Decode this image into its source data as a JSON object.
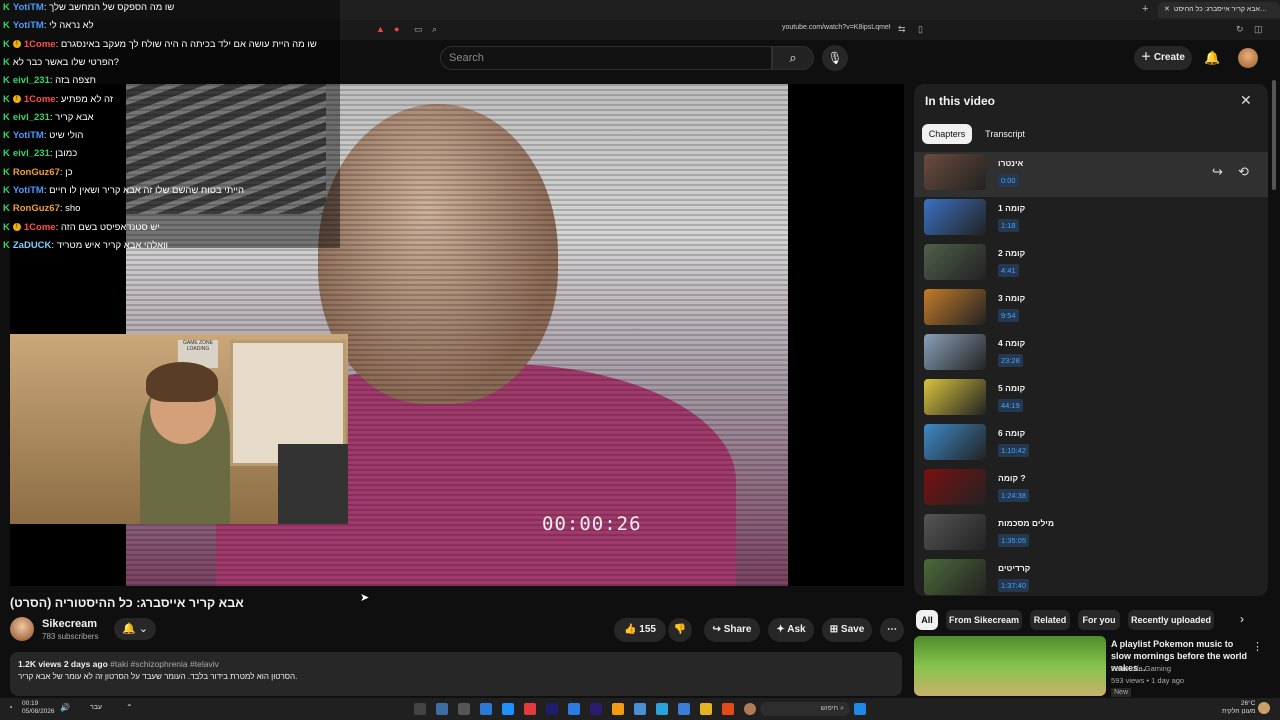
{
  "browser": {
    "tab_title": "אבא קריר אייסברג: כל ההיסט…",
    "url": "youtube.com/watch?v=K8ipsLqmeI"
  },
  "header": {
    "search_placeholder": "Search",
    "create_label": "Create"
  },
  "chat": [
    {
      "user": "YotiTM",
      "msg": "שו מה הספקס של המחשב שלך",
      "color": "#4b9bff",
      "badge": false
    },
    {
      "user": "YotiTM",
      "msg": "לא נראה לי",
      "color": "#4b9bff",
      "badge": false
    },
    {
      "user": "1Come",
      "msg": "שו מה היית עושה אם ילד בכיתה ה היה שולח לך מעקב באינסגרם",
      "color": "#ff4d4d",
      "badge": true
    },
    {
      "user": "",
      "msg": "הפרטי שלו באשר כבר לא?",
      "color": "#ffffff",
      "badge": false
    },
    {
      "user": "eivl_231",
      "msg": "תצפה בזה",
      "color": "#36d36b",
      "badge": false
    },
    {
      "user": "1Come",
      "msg": "זה לא מפתיע",
      "color": "#ff4d4d",
      "badge": true
    },
    {
      "user": "eivl_231",
      "msg": "אבא קריר",
      "color": "#36d36b",
      "badge": false
    },
    {
      "user": "YotiTM",
      "msg": "הולי שיט",
      "color": "#4b9bff",
      "badge": false
    },
    {
      "user": "eivl_231",
      "msg": "כמובן",
      "color": "#36d36b",
      "badge": false
    },
    {
      "user": "RonGuz67",
      "msg": "כן",
      "color": "#f0a030",
      "badge": false
    },
    {
      "user": "YotiTM",
      "msg": "הייתי בטוח שהשם שלו זה אבא קריר ושאין לו חיים",
      "color": "#4b9bff",
      "badge": false
    },
    {
      "user": "RonGuz67",
      "msg": "sho",
      "color": "#f0a030",
      "badge": false
    },
    {
      "user": "1Come",
      "msg": "יש סטנדאפיסט בשם הזה",
      "color": "#ff4d4d",
      "badge": true
    },
    {
      "user": "ZaDUCK",
      "msg": "וואלהי אבא קריר איש מטריד",
      "color": "#7ad0ff",
      "badge": false
    }
  ],
  "player": {
    "timecode": "00:00:26",
    "webcam_sign": "GAME ZONE LOADING"
  },
  "video": {
    "title": "אבא קריר אייסברג: כל ההיסטוריה (הסרט)",
    "channel": "Sikecream",
    "subscribers": "783 subscribers",
    "likes": "155",
    "share_label": "Share",
    "ask_label": "Ask",
    "save_label": "Save",
    "views_date": "1.2K views  2 days ago",
    "tags": "#taki #schizophrenia #telaviv",
    "description": "הסרטון הוא למטרת בידור בלבד. העומר שעבד על הסרטון זה לא עומר של אבא קריר."
  },
  "panel": {
    "title": "In this video",
    "tab_chapters": "Chapters",
    "tab_transcript": "Transcript",
    "chapters": [
      {
        "name": "אינטרו",
        "time": "0:00",
        "color": "#6b4b3e"
      },
      {
        "name": "קומה 1",
        "time": "1:18",
        "color": "#3a72c4"
      },
      {
        "name": "קומה 2",
        "time": "4:41",
        "color": "#4f5f4a"
      },
      {
        "name": "קומה 3",
        "time": "9:54",
        "color": "#c47b2a"
      },
      {
        "name": "קומה 4",
        "time": "23:28",
        "color": "#8aa0b8"
      },
      {
        "name": "קומה 5",
        "time": "44:19",
        "color": "#d9c43c"
      },
      {
        "name": "קומה 6",
        "time": "1:10:42",
        "color": "#3e8ac9"
      },
      {
        "name": "קומה ?",
        "time": "1:24:38",
        "color": "#7a1010"
      },
      {
        "name": "מילים מסכמות",
        "time": "1:35:05",
        "color": "#555555"
      },
      {
        "name": "קרדיטים",
        "time": "1:37:40",
        "color": "#4d6a3a"
      }
    ]
  },
  "chips": [
    "All",
    "From Sikecream",
    "Related",
    "For you",
    "Recently uploaded"
  ],
  "recommendation": {
    "title": "A playlist Pokemon music to slow mornings before the world wakes...",
    "channel": "Farm Life Gaming",
    "meta": "593 views • 1 day ago",
    "badge": "New"
  },
  "taskbar": {
    "time": "00:19",
    "date": "05/08/2026",
    "search_label": "חיפוש",
    "weather_temp": "26°C",
    "weather_desc": "מעונן חלקית",
    "lang": "עבר"
  },
  "colors": {
    "accent_blue": "#3ea6ff",
    "background": "#0f0f0f"
  }
}
